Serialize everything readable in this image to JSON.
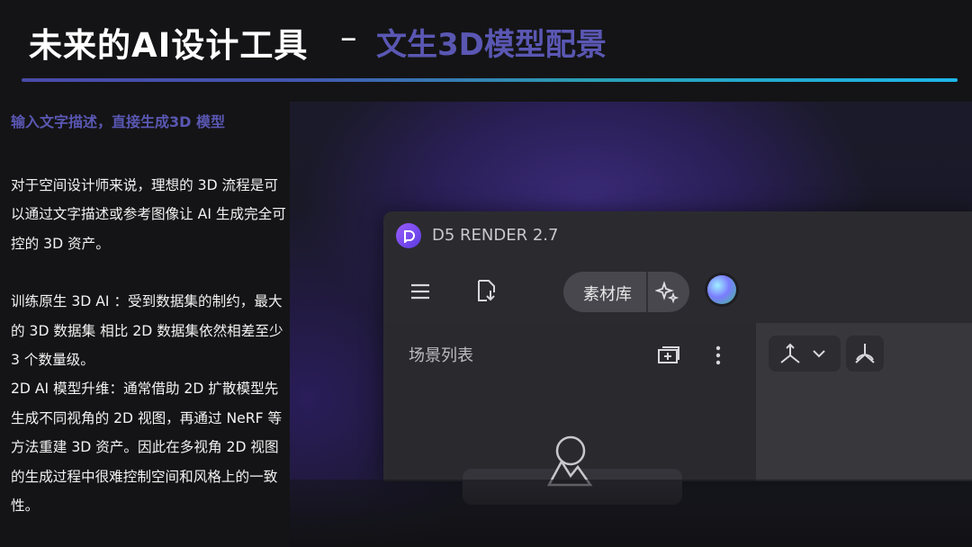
{
  "header": {
    "title": "未来的AI设计工具",
    "separator": "–",
    "subtitle": "文生3D模型配景"
  },
  "left": {
    "heading": "输入文字描述，直接生成3D 模型",
    "paragraph1": "对于空间设计师来说，理想的 3D 流程是可以通过文字描述或参考图像让 AI 生成完全可控的 3D 资产。",
    "paragraph2": "训练原生 3D AI ：受到数据集的制约，最大的 3D 数据集 相比 2D 数据集依然相差至少 3 个数量级。",
    "paragraph3": "2D AI 模型升维：通常借助 2D 扩散模型先生成不同视角的 2D 视图，再通过 NeRF 等方法重建 3D 资产。因此在多视角 2D 视图的生成过程中很难控制空间和风格上的一致性。"
  },
  "app": {
    "title": "D5 RENDER 2.7",
    "asset_library_label": "素材库",
    "scene_list_label": "场景列表",
    "icons": [
      "d5-logo-icon",
      "menu-icon",
      "import-file-icon",
      "ai-sparkle-icon",
      "color-orb-icon",
      "add-scene-icon",
      "more-vertical-icon",
      "axis-icon",
      "chevron-down-icon",
      "perspective-icon",
      "empty-mountain-icon"
    ]
  },
  "colors": {
    "accent": "#5a57b3",
    "background": "#141416",
    "rule_start": "#4a4aa8",
    "rule_end": "#1eb6e8"
  }
}
